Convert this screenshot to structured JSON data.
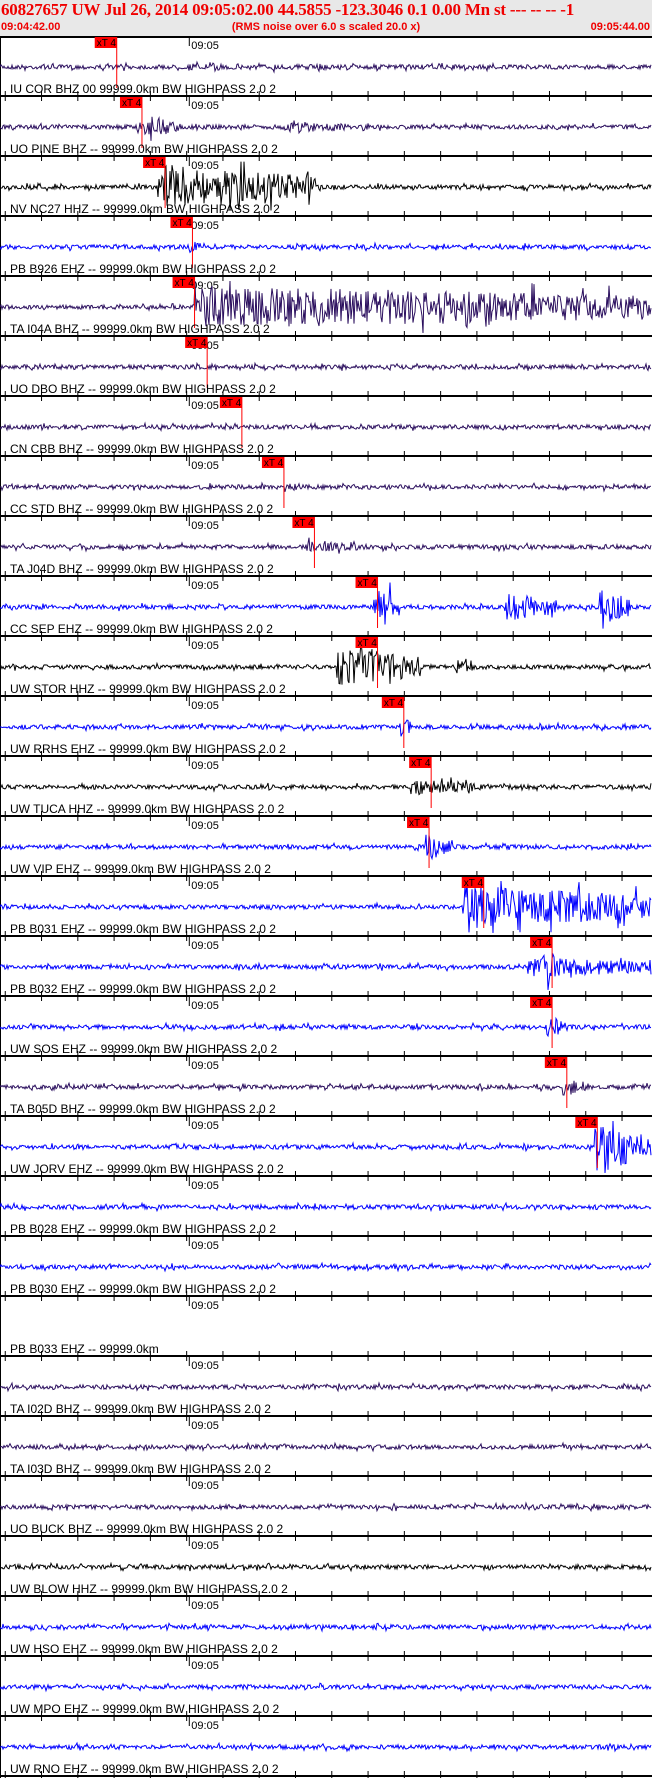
{
  "header": {
    "title": "60827657 UW Jul 26, 2014 09:05:02.00    44.5855 -123.3046  0.1 0.00 Mn st --- -- --   -1",
    "start_time": "09:04:42.00",
    "end_time": "09:05:44.00",
    "note": "(RMS noise over 6.0 s scaled 20.0 x)"
  },
  "chart_data": {
    "type": "line",
    "title": "Seismogram record section",
    "x_unit": "seconds after 09:04:42.00",
    "xlim": [
      0,
      62
    ],
    "minute_mark": {
      "label": "09:05",
      "t": 18
    },
    "pick_label": "xT 4",
    "colors": {
      "purple": "#2b0f5e",
      "black": "#000000",
      "blue": "#0000ff",
      "pick": "#ff0000"
    },
    "stations": [
      {
        "label": "IU COR BHZ 00 99999.0km BW  HIGHPASS  2.0  2",
        "color": "purple",
        "pick": 11.1
      },
      {
        "label": "UO PINE BHZ -- 99999.0km BW  HIGHPASS  2.0  2",
        "color": "purple",
        "pick": 13.5
      },
      {
        "label": "NV NC27 HHZ -- 99999.0km BW  HIGHPASS  2.0  2",
        "color": "black",
        "pick": 15.7
      },
      {
        "label": "PB B926 EHZ -- 99999.0km BW  HIGHPASS  2.0  2",
        "color": "blue",
        "pick": 18.3
      },
      {
        "label": "TA I04A BHZ -- 99999.0km BW  HIGHPASS  2.0  2",
        "color": "purple",
        "pick": 18.5
      },
      {
        "label": "UO DBO BHZ -- 99999.0km BW  HIGHPASS  2.0  2",
        "color": "purple",
        "pick": 19.7
      },
      {
        "label": "CN CBB BHZ -- 99999.0km BW  HIGHPASS  2.0  2",
        "color": "purple",
        "pick": 23.0
      },
      {
        "label": "CC STD BHZ -- 99999.0km BW  HIGHPASS  2.0  2",
        "color": "purple",
        "pick": 27.0
      },
      {
        "label": "TA J04D BHZ -- 99999.0km BW  HIGHPASS  2.0  2",
        "color": "purple",
        "pick": 29.9
      },
      {
        "label": "CC SEP EHZ -- 99999.0km BW  HIGHPASS  2.0  2",
        "color": "blue",
        "pick": 35.9
      },
      {
        "label": "UW STOR HHZ -- 99999.0km BW  HIGHPASS  2.0  2",
        "color": "black",
        "pick": 35.9
      },
      {
        "label": "UW RRHS EHZ -- 99999.0km BW  HIGHPASS  2.0  2",
        "color": "blue",
        "pick": 38.4
      },
      {
        "label": "UW TUCA HHZ -- 99999.0km BW  HIGHPASS  2.0  2",
        "color": "black",
        "pick": 41.0
      },
      {
        "label": "UW VIP EHZ -- 99999.0km BW  HIGHPASS  2.0  2",
        "color": "blue",
        "pick": 40.8
      },
      {
        "label": "PB B031 EHZ -- 99999.0km BW  HIGHPASS  2.0  2",
        "color": "blue",
        "pick": 46.0
      },
      {
        "label": "PB B032 EHZ -- 99999.0km BW  HIGHPASS  2.0  2",
        "color": "blue",
        "pick": 52.5
      },
      {
        "label": "UW SOS EHZ -- 99999.0km BW  HIGHPASS  2.0  2",
        "color": "blue",
        "pick": 52.5
      },
      {
        "label": "TA B05D BHZ -- 99999.0km BW  HIGHPASS  2.0  2",
        "color": "purple",
        "pick": 53.9
      },
      {
        "label": "UW JORV EHZ -- 99999.0km BW  HIGHPASS  2.0  2",
        "color": "blue",
        "pick": 56.8
      },
      {
        "label": "PB B028 EHZ -- 99999.0km BW  HIGHPASS  2.0  2",
        "color": "blue",
        "pick": null
      },
      {
        "label": "PB B030 EHZ -- 99999.0km BW  HIGHPASS  2.0  2",
        "color": "blue",
        "pick": null
      },
      {
        "label": "PB B033 EHZ -- 99999.0km",
        "color": "none",
        "pick": null
      },
      {
        "label": "TA I02D BHZ -- 99999.0km BW  HIGHPASS  2.0  2",
        "color": "purple",
        "pick": null
      },
      {
        "label": "TA I03D BHZ -- 99999.0km BW  HIGHPASS  2.0  2",
        "color": "purple",
        "pick": null
      },
      {
        "label": "UO BUCK BHZ -- 99999.0km BW  HIGHPASS  2.0  2",
        "color": "purple",
        "pick": null
      },
      {
        "label": "UW BLOW HHZ -- 99999.0km BW  HIGHPASS  2.0  2",
        "color": "black",
        "pick": null
      },
      {
        "label": "UW HSO EHZ -- 99999.0km BW  HIGHPASS  2.0  2",
        "color": "blue",
        "pick": null
      },
      {
        "label": "UW MPO EHZ -- 99999.0km BW  HIGHPASS  2.0  2",
        "color": "blue",
        "pick": null
      },
      {
        "label": "UW RNO EHZ -- 99999.0km BW  HIGHPASS  2.0  2",
        "color": "blue",
        "pick": null
      }
    ]
  }
}
